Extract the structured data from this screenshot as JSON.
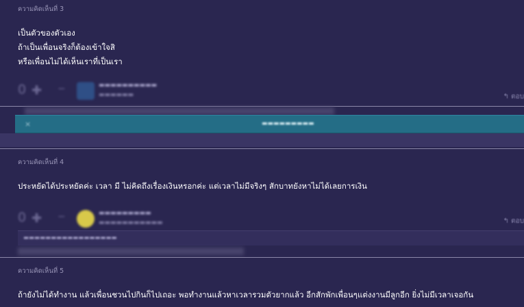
{
  "comments": [
    {
      "header": "ความคิดเห็นที่ 3",
      "lines": [
        "เป็นตัวของตัวเอง",
        "ถ้าเป็นเพื่อนจริงก็ต้องเข้าใจสิ",
        "หรือเพื่อนไม่ได้เห็นเราที่เป็นเรา"
      ],
      "votes": "0",
      "reply_label": "ตอบ"
    },
    {
      "header": "ความคิดเห็นที่ 4",
      "lines": [
        "ประหยัดได้ประหยัดค่ะ เวลา มี ไม่คิดถึงเรื่องเงินหรอกค่ะ แต่เวลาไม่มีจริงๆ สักบาทยังหาไม่ได้เลยการเงิน"
      ],
      "votes": "0",
      "reply_label": "ตอบ"
    },
    {
      "header": "ความคิดเห็นที่ 5",
      "lines": [
        "ถ้ายังไม่ได้ทำงาน แล้วเพื่อนชวนไปกินก็ไปเถอะ พอทำงานแล้วหาเวลารวมตัวยากแล้ว อีกสักพักเพื่อนๆแต่งงานมีลูกอีก ยิ่งไม่มีเวลาเจอกัน"
      ]
    }
  ],
  "icons": {
    "plus": "plus-icon",
    "minus": "minus-icon",
    "reply": "reply-arrow-icon",
    "close": "close-icon"
  },
  "colors": {
    "background": "#2a2650",
    "reply_bar": "#246d86",
    "avatar_1": "#2f4f86",
    "avatar_2": "#d8c94a"
  }
}
